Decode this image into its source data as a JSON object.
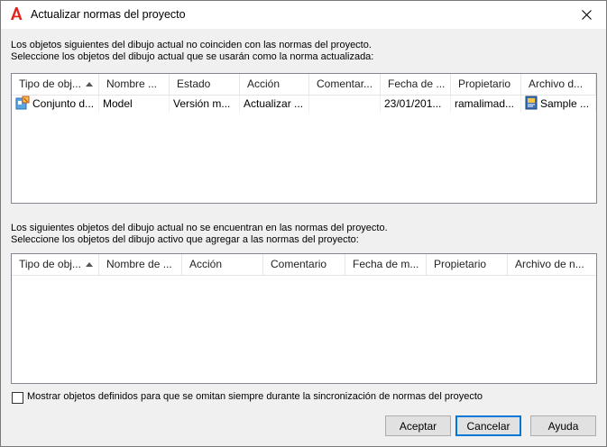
{
  "window": {
    "title": "Actualizar normas del proyecto",
    "close_label": "✕"
  },
  "section1": {
    "line1": "Los objetos siguientes del dibujo actual no coinciden con las normas del proyecto.",
    "line2": "Seleccione los objetos del dibujo actual que se usarán como la norma actualizada:",
    "columns": [
      "Tipo de obj...",
      "Nombre ...",
      "Estado",
      "Acción",
      "Comentar...",
      "Fecha de ...",
      "Propietario",
      "Archivo d..."
    ],
    "rows": [
      {
        "icon": "block-definition-icon",
        "cells": [
          "Conjunto d...",
          "Model",
          "Versión m...",
          "Actualizar ...",
          "",
          "23/01/201...",
          "ramalimad...",
          "Sample ..."
        ]
      }
    ]
  },
  "section2": {
    "line1": "Los siguientes objetos del dibujo actual no se encuentran en las normas del proyecto.",
    "line2": "Seleccione los objetos del dibujo activo que agregar a las normas del proyecto:",
    "columns": [
      "Tipo de obj...",
      "Nombre de ...",
      "Acción",
      "Comentario",
      "Fecha de m...",
      "Propietario",
      "Archivo de n..."
    ]
  },
  "footer": {
    "checkbox_label": "Mostrar objetos definidos para que se omitan siempre durante la sincronización de normas del proyecto",
    "checkbox_checked": false,
    "accept_label": "Aceptar",
    "cancel_label": "Cancelar",
    "help_label": "Ayuda"
  },
  "colors": {
    "accent": "#0078d7",
    "autocad_red": "#e2231a"
  }
}
